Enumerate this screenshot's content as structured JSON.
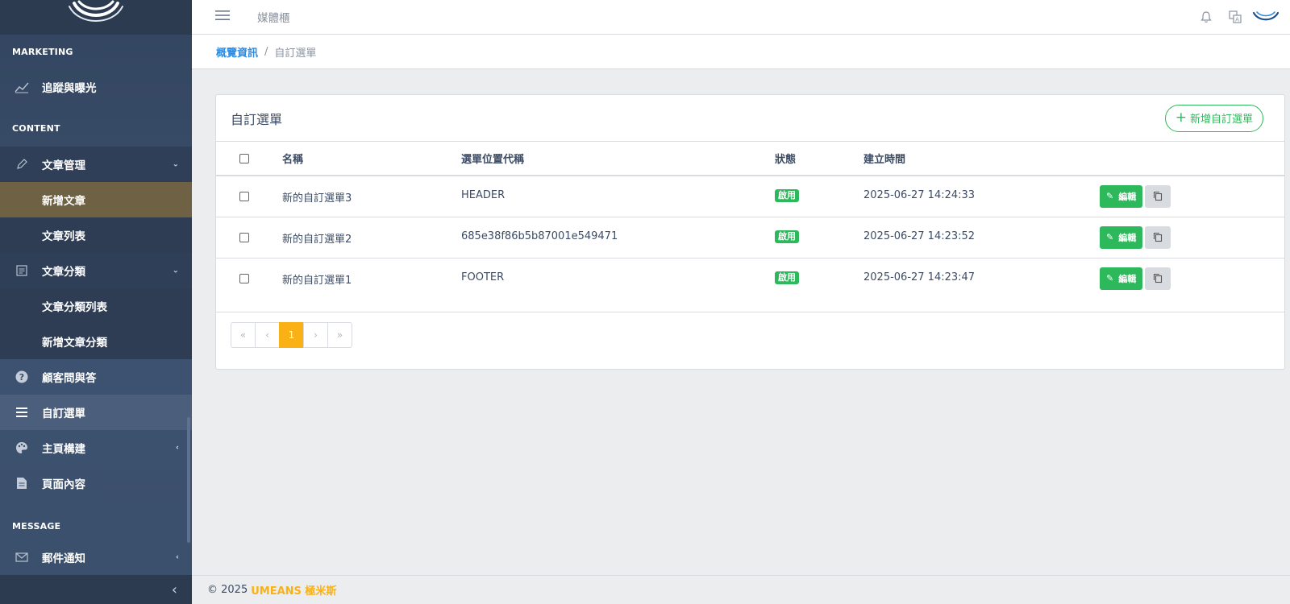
{
  "header": {
    "link": "媒體櫃"
  },
  "sidebar": {
    "sections": {
      "marketing": "MARKETING",
      "content": "CONTENT",
      "message": "MESSAGE"
    },
    "items": {
      "tracking": "追蹤與曝光",
      "articles": "文章管理",
      "new_article": "新增文章",
      "article_list": "文章列表",
      "categories": "文章分類",
      "category_list": "文章分類列表",
      "new_category": "新增文章分類",
      "faq": "顧客問與答",
      "custom_menu": "自訂選單",
      "homepage_builder": "主頁構建",
      "page_content": "頁面內容",
      "mail": "郵件通知"
    }
  },
  "breadcrumb": {
    "home": "概覽資訊",
    "separator": "/",
    "current": "自訂選單"
  },
  "card": {
    "title": "自訂選單",
    "add_button": "新增自訂選單",
    "columns": {
      "name": "名稱",
      "code": "選單位置代稱",
      "status": "狀態",
      "created": "建立時間"
    },
    "rows": [
      {
        "name": "新的自訂選單3",
        "code": "HEADER",
        "status": "啟用",
        "created": "2025-06-27 14:24:33",
        "edit": "編輯"
      },
      {
        "name": "新的自訂選單2",
        "code": "685e38f86b5b87001e549471",
        "status": "啟用",
        "created": "2025-06-27 14:23:52",
        "edit": "編輯"
      },
      {
        "name": "新的自訂選單1",
        "code": "FOOTER",
        "status": "啟用",
        "created": "2025-06-27 14:23:47",
        "edit": "編輯"
      }
    ]
  },
  "pagination": {
    "first": "«",
    "prev": "‹",
    "current": "1",
    "next": "›",
    "last": "»"
  },
  "footer": {
    "copyright": "© 2025",
    "brand": "UMEANS 極米斯"
  },
  "colors": {
    "primary_green": "#2eb85c",
    "accent_yellow": "#f9b115",
    "link_blue": "#2f8ae0",
    "sidebar_bg": "#3a4f6b"
  }
}
